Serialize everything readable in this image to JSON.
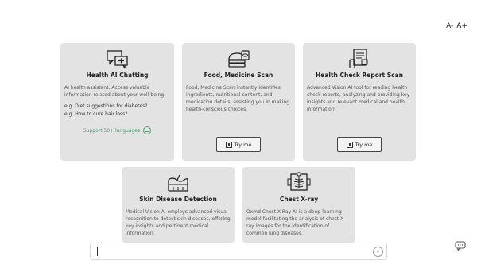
{
  "font_controls": {
    "decrease": "A-",
    "increase": "A+"
  },
  "cards": [
    {
      "title": "Health AI Chatting",
      "desc": "AI health assistant. Access valuable information related about your well-being.",
      "examples": [
        "e.g. Diet suggestions for diabetes?",
        "e.g. How to cure hair loss?"
      ],
      "support": "Support 50+ languages",
      "icon": "chat-bubbles-icon"
    },
    {
      "title": "Food, Medicine Scan",
      "desc": "Food, Medicine Scan instantly identifies ingredients, nutritional content, and medication details, assisting you in making health-conscious choices.",
      "button": "Try me",
      "icon": "food-medicine-icon"
    },
    {
      "title": "Health Check Report Scan",
      "desc": "Advanced Vision AI tool for reading health check reports, analyzing and providing key insights and relevant medical and health information.",
      "button": "Try me",
      "icon": "report-scan-icon"
    },
    {
      "title": "Skin Disease Detection",
      "desc": "Medical Vision AI employs advanced visual recognition to detect skin diseases, offering key insights and pertinent medical information.",
      "icon": "skin-layers-icon"
    },
    {
      "title": "Chest X-ray",
      "desc": "Oxmd Chest X-Ray AI is a deep-learning model facilitating the analysis of chest X-ray images for the identification of common lung diseases.",
      "icon": "chest-xray-icon"
    }
  ],
  "input": {
    "placeholder": "",
    "value": ""
  },
  "colors": {
    "card_bg": "#e3e3e3",
    "accent_green": "#3aa56b"
  }
}
